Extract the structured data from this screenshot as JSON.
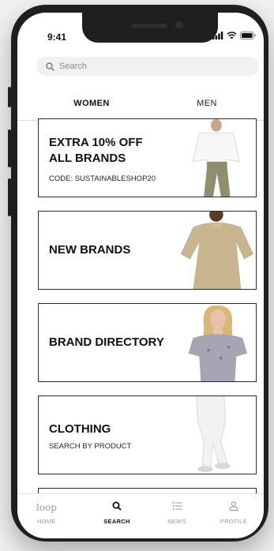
{
  "status": {
    "time": "9:41"
  },
  "search": {
    "placeholder": "Search"
  },
  "tabs": [
    {
      "label": "WOMEN",
      "active": true
    },
    {
      "label": "MEN",
      "active": false
    }
  ],
  "cards": [
    {
      "title_line1": "EXTRA 10% OFF",
      "title_line2": "ALL BRANDS",
      "subtitle": "CODE: SUSTAINABLESHOP20"
    },
    {
      "title": "NEW BRANDS"
    },
    {
      "title": "BRAND DIRECTORY"
    },
    {
      "title": "CLOTHING",
      "subtitle": "SEARCH BY PRODUCT"
    }
  ],
  "nav": {
    "logo": "loop",
    "items": [
      {
        "label": "HOME",
        "icon": "loop-logo-icon"
      },
      {
        "label": "SEARCH",
        "icon": "search-icon",
        "active": true
      },
      {
        "label": "NEWS",
        "icon": "list-icon"
      },
      {
        "label": "PROFILE",
        "icon": "user-icon"
      }
    ]
  },
  "colors": {
    "frame": "#1f1f21",
    "accent": "#111111",
    "inactive": "#9a9a9a",
    "search_bg": "#f1f1f1"
  }
}
